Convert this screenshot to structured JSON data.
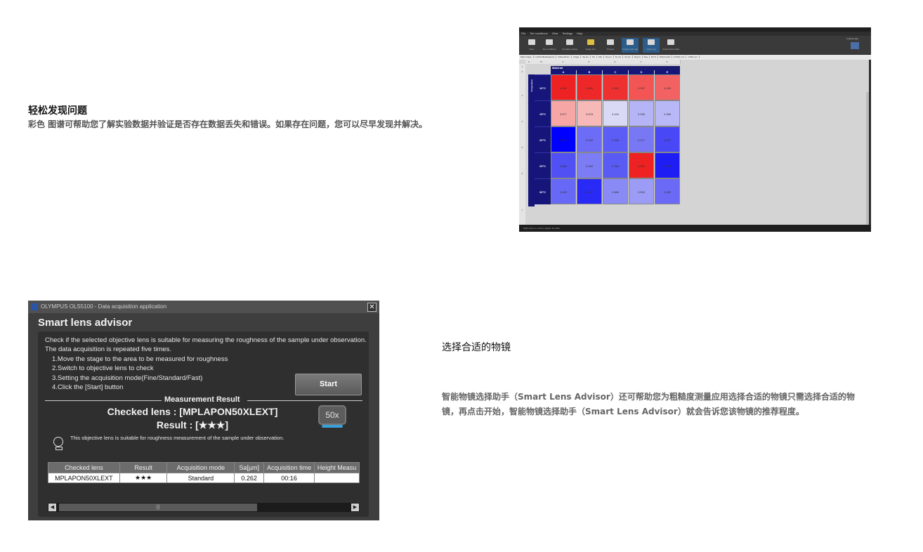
{
  "section1": {
    "title": "轻松发现问题",
    "description": "彩色 图谱可帮助您了解实验数据并验证是否存在数据丢失和错误。如果存在问题，您可以尽早发现并解决。"
  },
  "section2": {
    "title": "选择合适的物镜",
    "description": "智能物镜选择助手（Smart Lens Advisor）还可帮助您为粗糙度测量应用选择合适的物镜只需选择合适的物镜，再点击开始，智能物镜选择助手（Smart Lens Advisor）就会告诉您该物镜的推荐程度。"
  },
  "heatmap_app": {
    "menu": [
      "File",
      "Set conditions",
      "View",
      "Settings",
      "Help"
    ],
    "toolbar": [
      {
        "label": "Open",
        "icon": "open-icon"
      },
      {
        "label": "Set conditions",
        "icon": "conditions-icon"
      },
      {
        "label": "Template setting",
        "icon": "template-icon"
      },
      {
        "label": "Image info.",
        "icon": "image-info-icon"
      },
      {
        "label": "Presets",
        "icon": "presets-icon"
      },
      {
        "label": "Create heat map",
        "icon": "create-heatmap-icon"
      },
      {
        "label": "Heat map",
        "icon": "heatmap-icon"
      },
      {
        "label": "Output Excel data",
        "icon": "excel-icon"
      }
    ],
    "analysis_label": "Analysis app.",
    "tabs": [
      "Main image",
      "LineProfileHistogram",
      "Filtered/Line",
      "Image",
      "Sa µm",
      "Str",
      "Sku",
      "Sp µm",
      "Sv µm",
      "Sz µm",
      "Sa µm",
      "Ssq",
      "Str %",
      "PQiconvalv",
      "FLTRer µm",
      "1.25er µm"
    ],
    "column_letters": [
      "A",
      "B",
      "C",
      "D",
      "E",
      "F",
      "G"
    ],
    "row_numbers": [
      "1",
      "2",
      "3",
      "4",
      "5",
      "6",
      "7"
    ],
    "chart_data": {
      "type": "heatmap",
      "title": "Material",
      "ylabel": "Temperature",
      "columns": [
        "A",
        "B",
        "C",
        "D",
        "E"
      ],
      "rows": [
        "10°C",
        "15°C",
        "20°C",
        "25°C",
        "30°C"
      ],
      "values": [
        [
          "4.090",
          "4.456",
          "4.362",
          "4.297",
          "4.155"
        ],
        [
          "3.677",
          "3.678",
          "3.434",
          "3.058",
          "2.985"
        ],
        [
          "2.201",
          "3.339",
          "2.996",
          "3.477",
          "2.827"
        ],
        [
          "2.866",
          "2.600",
          "2.784",
          "4.299",
          "2.318"
        ],
        [
          "2.843",
          "2.327",
          "2.866",
          "3.505",
          "2.450"
        ]
      ],
      "colors": [
        [
          "#ee2222",
          "#ee2828",
          "#ef3030",
          "#f35454",
          "#f36262"
        ],
        [
          "#f7a6a6",
          "#f7b8b8",
          "#d9d9f6",
          "#b4b4f6",
          "#b8b8f6"
        ],
        [
          "#0000ff",
          "#6c6cf6",
          "#5c5cf6",
          "#7878f4",
          "#4848f6"
        ],
        [
          "#5050f4",
          "#7c7cf4",
          "#5a5af4",
          "#ee2222",
          "#1e1ef4"
        ],
        [
          "#6868f6",
          "#2a2af6",
          "#8a8af6",
          "#9c9cf6",
          "#6a6af6"
        ]
      ]
    },
    "status": "Right-click on a cell to register the data."
  },
  "advisor": {
    "window_title": "OLYMPUS OLS5100 - Data acquisition application",
    "close_glyph": "✕",
    "heading": "Smart lens advisor",
    "intro1": "Check if the selected objective lens is suitable for measuring the roughness of the sample under observation.",
    "intro2": "The data acquisition is repeated five times.",
    "step1": "1.Move the stage to the area to be measured for roughness",
    "step2": "2.Switch to objective lens to check",
    "step3": "3.Setting the acquisition mode(Fine/Standard/Fast)",
    "step4": "4.Click the [Start] button",
    "start_label": "Start",
    "measurement_label": "Measurement Result",
    "checked_lens_text": "Checked lens  :  [MPLAPON50XLEXT]",
    "result_text": "Result  :  [★★★]",
    "mag_label": "50x",
    "note": "This objective lens is suitable for roughness measurement of the sample under observation.",
    "table": {
      "headers": [
        "Checked lens",
        "Result",
        "Acquisition mode",
        "Sa[µm]",
        "Acquisition time",
        "Height Measu"
      ],
      "rows": [
        [
          "MPLAPON50XLEXT",
          "★★★",
          "Standard",
          "0.262",
          "00:16",
          ""
        ]
      ]
    },
    "scroll_thumb_glyph": "|||",
    "left_arrow": "◀",
    "right_arrow": "▶"
  }
}
